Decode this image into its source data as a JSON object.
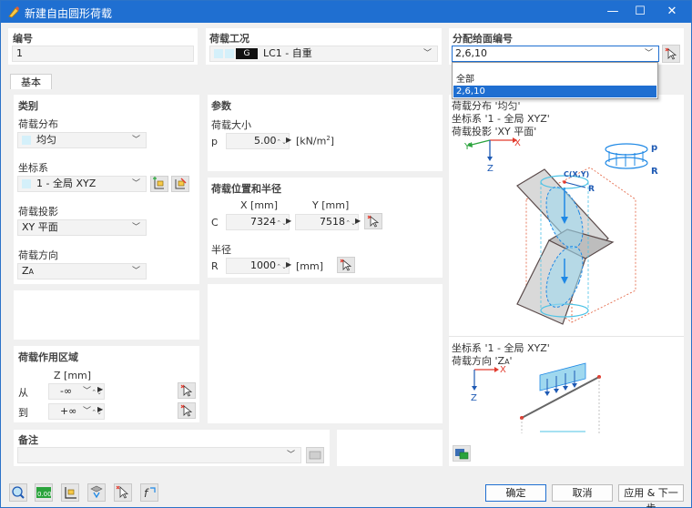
{
  "window": {
    "title": "新建自由圆形荷载",
    "minimize": "—",
    "maximize": "☐",
    "close": "✕"
  },
  "number": {
    "label": "编号",
    "value": "1"
  },
  "load_case": {
    "label": "荷载工况",
    "badge": "G",
    "value": "LC1 - 自重"
  },
  "assign": {
    "label": "分配给面编号",
    "value": "2,6,10",
    "options": [
      "全部",
      "2,6,10"
    ],
    "selected": "2,6,10"
  },
  "tab": {
    "label": "基本"
  },
  "category": {
    "title": "类别",
    "distribution_label": "荷载分布",
    "distribution_value": "均匀",
    "coord_label": "坐标系",
    "coord_value": "1 - 全局 XYZ",
    "projection_label": "荷载投影",
    "projection_value": "XY 平面",
    "direction_label": "荷载方向",
    "direction_value": "Z",
    "direction_sub": "A"
  },
  "params": {
    "title": "参数",
    "magnitude_label": "荷载大小",
    "p_label": "p",
    "p_value": "5.00",
    "p_unit": "[kN/m",
    "p_unit_sup": "2",
    "p_unit_end": "]"
  },
  "position": {
    "title": "荷载位置和半径",
    "x_header": "X [mm]",
    "y_header": "Y [mm]",
    "c_label": "C",
    "x_value": "7324",
    "y_value": "7518",
    "radius_label": "半径",
    "r_label": "R",
    "r_value": "1000",
    "r_unit": "[mm]"
  },
  "area": {
    "title": "荷载作用区域",
    "z_header": "Z [mm]",
    "from_label": "从",
    "from_value": "-∞",
    "to_label": "到",
    "to_value": "+∞"
  },
  "note": {
    "label": "备注",
    "value": ""
  },
  "preview": {
    "line1": "荷载分布 '均匀'",
    "line2": "坐标系 '1 - 全局 XYZ'",
    "line3": "荷载投影 'XY 平面'",
    "line4": "坐标系 '1 - 全局 XYZ'",
    "line5": "荷载方向 'Z",
    "line5_sub": "A",
    "line5_end": "'",
    "axis_x": "X",
    "axis_y": "Y",
    "axis_z": "Z",
    "label_p": "p",
    "label_r": "R",
    "label_c": "C(X,Y)"
  },
  "buttons": {
    "ok": "确定",
    "cancel": "取消",
    "apply_next": "应用 & 下一步"
  },
  "colors": {
    "accent": "#1f6fd1",
    "load": "#1e88e5",
    "cyan": "#4ec3e6",
    "red": "#e23b2e",
    "green": "#2aa33c"
  }
}
